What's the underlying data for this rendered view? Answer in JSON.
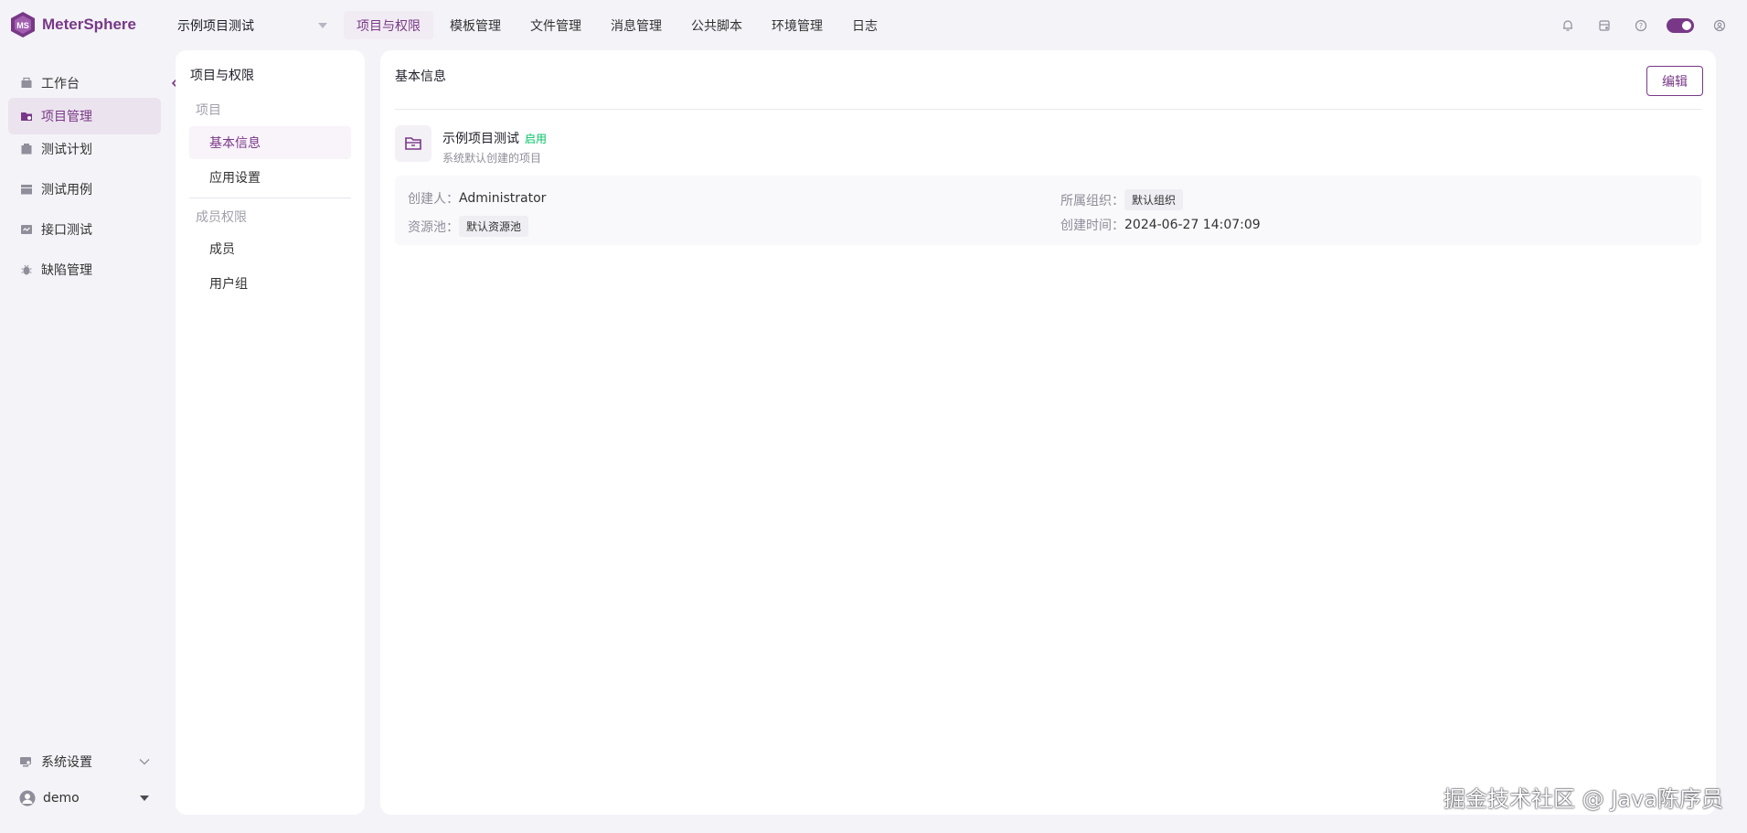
{
  "app": {
    "name": "MeterSphere",
    "brand_color": "#783887"
  },
  "header": {
    "project_selector": "示例项目测试",
    "nav": [
      "项目与权限",
      "模板管理",
      "文件管理",
      "消息管理",
      "公共脚本",
      "环境管理",
      "日志"
    ],
    "active_nav": "项目与权限",
    "icons": [
      "bell-icon",
      "task-icon",
      "help-icon",
      "theme-toggle",
      "user-settings-icon"
    ]
  },
  "sidebar": {
    "items": [
      {
        "label": "工作台",
        "icon": "workbench-icon"
      },
      {
        "label": "项目管理",
        "icon": "project-icon",
        "active": true
      },
      {
        "label": "测试计划",
        "icon": "test-plan-icon"
      },
      {
        "label": "测试用例",
        "icon": "test-case-icon"
      },
      {
        "label": "接口测试",
        "icon": "api-test-icon"
      },
      {
        "label": "缺陷管理",
        "icon": "bug-icon"
      }
    ],
    "system_settings": "系统设置",
    "user": "demo"
  },
  "submenu": {
    "title": "项目与权限",
    "group_project": "项目",
    "items_project": [
      "基本信息",
      "应用设置"
    ],
    "group_members": "成员权限",
    "items_members": [
      "成员",
      "用户组"
    ],
    "active": "基本信息"
  },
  "main": {
    "title": "基本信息",
    "edit_label": "编辑",
    "project": {
      "name": "示例项目测试",
      "status": "启用",
      "description": "系统默认创建的项目"
    },
    "info": {
      "creator_label": "创建人",
      "creator": "Administrator",
      "org_label": "所属组织",
      "org": "默认组织",
      "pool_label": "资源池",
      "pool": "默认资源池",
      "created_label": "创建时间",
      "created": "2024-06-27 14:07:09"
    }
  },
  "watermark": "掘金技术社区 @ Java陈序员"
}
